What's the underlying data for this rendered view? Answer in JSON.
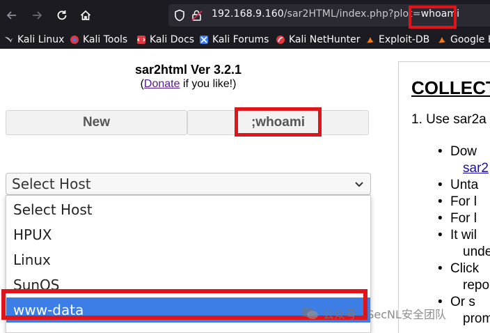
{
  "browser": {
    "url_prefix": "192.168.9.160",
    "url_path": "/sar2HTML/index.php?plot=",
    "url_highlight": "whoami",
    "bookmarks": [
      {
        "label": "Kali Linux",
        "icon": "kali-dragon-icon",
        "color": "#367bf0"
      },
      {
        "label": "Kali Tools",
        "icon": "kali-tools-icon",
        "color": "#e0383e"
      },
      {
        "label": "Kali Docs",
        "icon": "kali-docs-icon",
        "color": "#e0383e"
      },
      {
        "label": "Kali Forums",
        "icon": "kali-forums-icon",
        "color": "#367bf0"
      },
      {
        "label": "Kali NetHunter",
        "icon": "nethunter-icon",
        "color": "#e0383e"
      },
      {
        "label": "Exploit-DB",
        "icon": "exploitdb-icon",
        "color": "#f07b1e"
      },
      {
        "label": "Google H",
        "icon": "google-hacking-icon",
        "color": "#f07b1e"
      }
    ]
  },
  "page": {
    "title": "sar2html Ver 3.2.1",
    "donate_prefix": "(",
    "donate_link": "Donate",
    "donate_suffix": " if you like!)",
    "tabs": [
      "New",
      ";whoami"
    ],
    "select": {
      "value": "Select Host",
      "options": [
        "Select Host",
        "HPUX",
        "Linux",
        "SunOS",
        "www-data"
      ],
      "highlighted_option": "www-data"
    }
  },
  "right_panel": {
    "heading": "COLLECT",
    "step": "1. Use sar2a",
    "bullets": [
      {
        "text": "Dow",
        "cont": "sar2",
        "cont_link": true
      },
      {
        "text": "Unta"
      },
      {
        "text": "For l"
      },
      {
        "text": "For l"
      },
      {
        "text": "It wil",
        "cont": "unde"
      },
      {
        "text": "Click",
        "cont": "repo"
      },
      {
        "text": "Or s",
        "cont": "prom"
      }
    ]
  },
  "watermark": "公众号 · SecNL安全团队",
  "colors": {
    "highlight_red": "#e0141b",
    "selected_option_blue": "#3d7ee6",
    "chrome_bg": "#1c1b22"
  }
}
